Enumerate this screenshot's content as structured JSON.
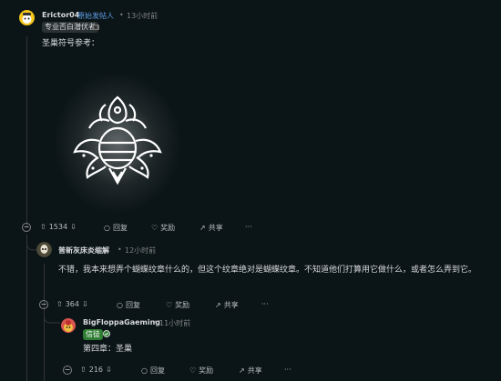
{
  "comment1": {
    "username": "Erictor04",
    "op_label": "原始发帖人",
    "time": "13小时前",
    "flair": "专业否白潜伏者",
    "body": "圣巢符号参考：",
    "votes": "1534",
    "reply_label": "回复",
    "award_label": "奖励",
    "share_label": "共享",
    "more_label": "···"
  },
  "comment2": {
    "username": "普新灰床炎缩解",
    "time": "12小时前",
    "body": "不错，我本来想弄个蝴蝶纹章什么的，但这个纹章绝对是蝴蝶纹章。不知道他们打算用它做什么，或者怎么弄到它。",
    "votes": "364",
    "reply_label": "回复",
    "award_label": "奖励",
    "share_label": "共享",
    "more_label": "···"
  },
  "comment3": {
    "username": "BigFloppaGaeming",
    "time": "11小时前",
    "flair": "信徒",
    "body": "第四章：圣巢",
    "votes": "216",
    "reply_label": "回复",
    "award_label": "奖励",
    "share_label": "共享",
    "more_label": "···"
  },
  "colors": {
    "background": "#0b1416",
    "op_blue": "#5f9ee8",
    "flair_green": "#2e7d32"
  }
}
